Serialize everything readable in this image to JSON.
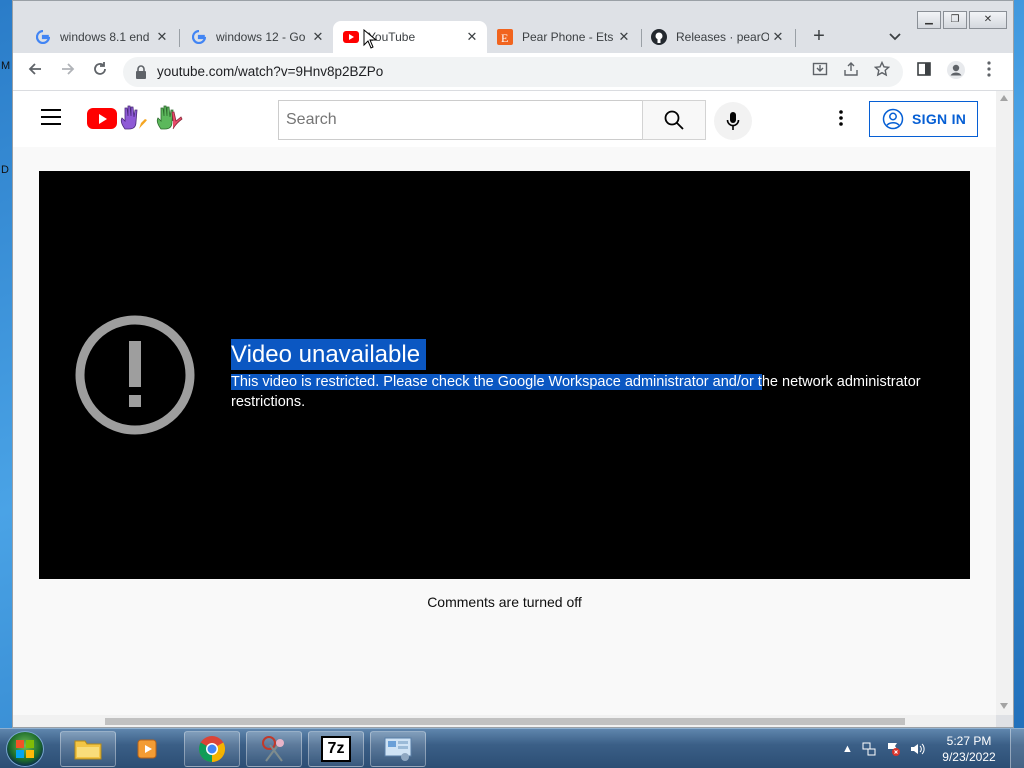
{
  "desktop": {
    "edge_letters": [
      "M",
      "D"
    ]
  },
  "window_controls": {
    "minimize": "minimize-icon",
    "restore": "restore-icon",
    "close": "close-icon"
  },
  "tabs": [
    {
      "title": "windows 8.1 end",
      "favicon": "google-icon",
      "active": false
    },
    {
      "title": "windows 12 - Go",
      "favicon": "google-icon",
      "active": false
    },
    {
      "title": "YouTube",
      "favicon": "youtube-icon",
      "active": true
    },
    {
      "title": "Pear Phone - Ets",
      "favicon": "etsy-icon",
      "active": false
    },
    {
      "title": "Releases · pearO",
      "favicon": "github-icon",
      "active": false
    }
  ],
  "toolbar": {
    "url": "youtube.com/watch?v=9Hnv8p2BZPo"
  },
  "youtube": {
    "search_placeholder": "Search",
    "sign_in_label": "SIGN IN"
  },
  "player": {
    "error_title": "Video unavailable",
    "error_message_selected": "This video is restricted. Please check the Google Workspace administrator and/or t",
    "error_message_rest": "he network administrator restrictions."
  },
  "comments_status": "Comments are turned off",
  "taskbar": {
    "apps": [
      "folder-icon",
      "media-player-icon",
      "chrome-icon",
      "snipping-tool-icon",
      "7zip-icon",
      "control-panel-icon"
    ],
    "seven_zip_label": "7z",
    "clock_time": "5:27 PM",
    "clock_date": "9/23/2022"
  },
  "colors": {
    "youtube_red": "#ff0000",
    "selection": "#0b57c2",
    "sign_in_blue": "#065fd4",
    "player_bg": "#000000"
  }
}
